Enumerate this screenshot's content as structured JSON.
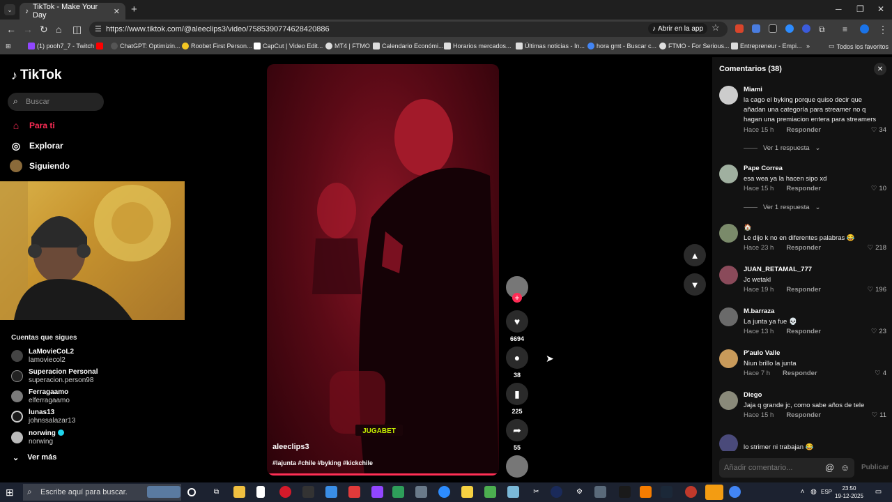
{
  "browser": {
    "tab_title": "TikTok - Make Your Day",
    "url": "https://www.tiktok.com/@aleeclips3/video/7585390774628420886",
    "open_in_app": "Abrir en la app",
    "bookmarks": [
      {
        "label": "(1) pooh7_7 - Twitch",
        "color": "#9146ff"
      },
      {
        "label": "",
        "color": "#ff0000"
      },
      {
        "label": "ChatGPT: Optimizin...",
        "color": "#555"
      },
      {
        "label": "Roobet First Person...",
        "color": "#f3c623"
      },
      {
        "label": "CapCut | Video Edit...",
        "color": "#fff"
      },
      {
        "label": "MT4 | FTMO",
        "color": "#ddd"
      },
      {
        "label": "Calendario Económi...",
        "color": "#ddd"
      },
      {
        "label": "Horarios mercados...",
        "color": "#ddd"
      },
      {
        "label": "Últimas noticias - In...",
        "color": "#ddd"
      },
      {
        "label": "hora gmt - Buscar c...",
        "color": "#4285f4"
      },
      {
        "label": "FTMO - For Serious...",
        "color": "#ddd"
      },
      {
        "label": "Entrepreneur - Empi...",
        "color": "#ddd"
      }
    ],
    "all_favorites": "Todos los favoritos"
  },
  "sidebar": {
    "logo": "TikTok",
    "search_placeholder": "Buscar",
    "nav": [
      {
        "label": "Para ti",
        "icon": "home-icon",
        "active": true
      },
      {
        "label": "Explorar",
        "icon": "compass-icon"
      },
      {
        "label": "Siguiendo",
        "icon": "following-icon"
      }
    ],
    "following_title": "Cuentas que sigues",
    "accounts": [
      {
        "name": "LaMovieCoL2",
        "handle": "lamoviecol2"
      },
      {
        "name": "Superacion Personal",
        "handle": "superacion.person98"
      },
      {
        "name": "Ferragaamo",
        "handle": "elferragaamo"
      },
      {
        "name": "lunas13",
        "handle": "johnssalazar13"
      },
      {
        "name": "norwing",
        "handle": "norwing",
        "verified": true
      }
    ],
    "see_more": "Ver más"
  },
  "video": {
    "username": "aleeclips3",
    "hashtags": "#lajunta #chile #byking #kickchile",
    "watermark": "JUGABET",
    "likes": "6694",
    "comments": "38",
    "saves": "225",
    "shares": "55"
  },
  "comments": {
    "title": "Comentarios (38)",
    "reply_label": "Responder",
    "items": [
      {
        "author": "Miami",
        "text": "la cago el byking porque quiso decir que añadan una categoría para streamer no q hagan una premiacion entera para streamers",
        "time": "Hace 15 h",
        "likes": "34",
        "replies": "Ver 1 respuesta"
      },
      {
        "author": "Pape Correa",
        "text": "esa wea ya la hacen sipo xd",
        "time": "Hace 15 h",
        "likes": "10",
        "replies": "Ver 1 respuesta"
      },
      {
        "author": "🏠",
        "text": "Le dijo k no en diferentes palabras 😂",
        "time": "Hace 23 h",
        "likes": "218"
      },
      {
        "author": "JUAN_RETAMAL_777",
        "text": "Jc wetakl",
        "time": "Hace 19 h",
        "likes": "196"
      },
      {
        "author": "M.barraza",
        "text": "La junta ya fue 💀",
        "time": "Hace 13 h",
        "likes": "23"
      },
      {
        "author": "P'aulo Valle",
        "text": "Niun brillo la junta",
        "time": "Hace 7 h",
        "likes": "4"
      },
      {
        "author": "Diego",
        "text": "Jaja q grande jc, como sabe años de tele",
        "time": "Hace 15 h",
        "likes": "11"
      },
      {
        "author": "",
        "text": "lo strimer ni trabajan 😂"
      }
    ],
    "add_placeholder": "Añadir comentario...",
    "publish": "Publicar"
  },
  "taskbar": {
    "search_placeholder": "Escribe aquí para buscar.",
    "lang": "ESP",
    "time": "23:50",
    "date": "19-12-2025"
  }
}
